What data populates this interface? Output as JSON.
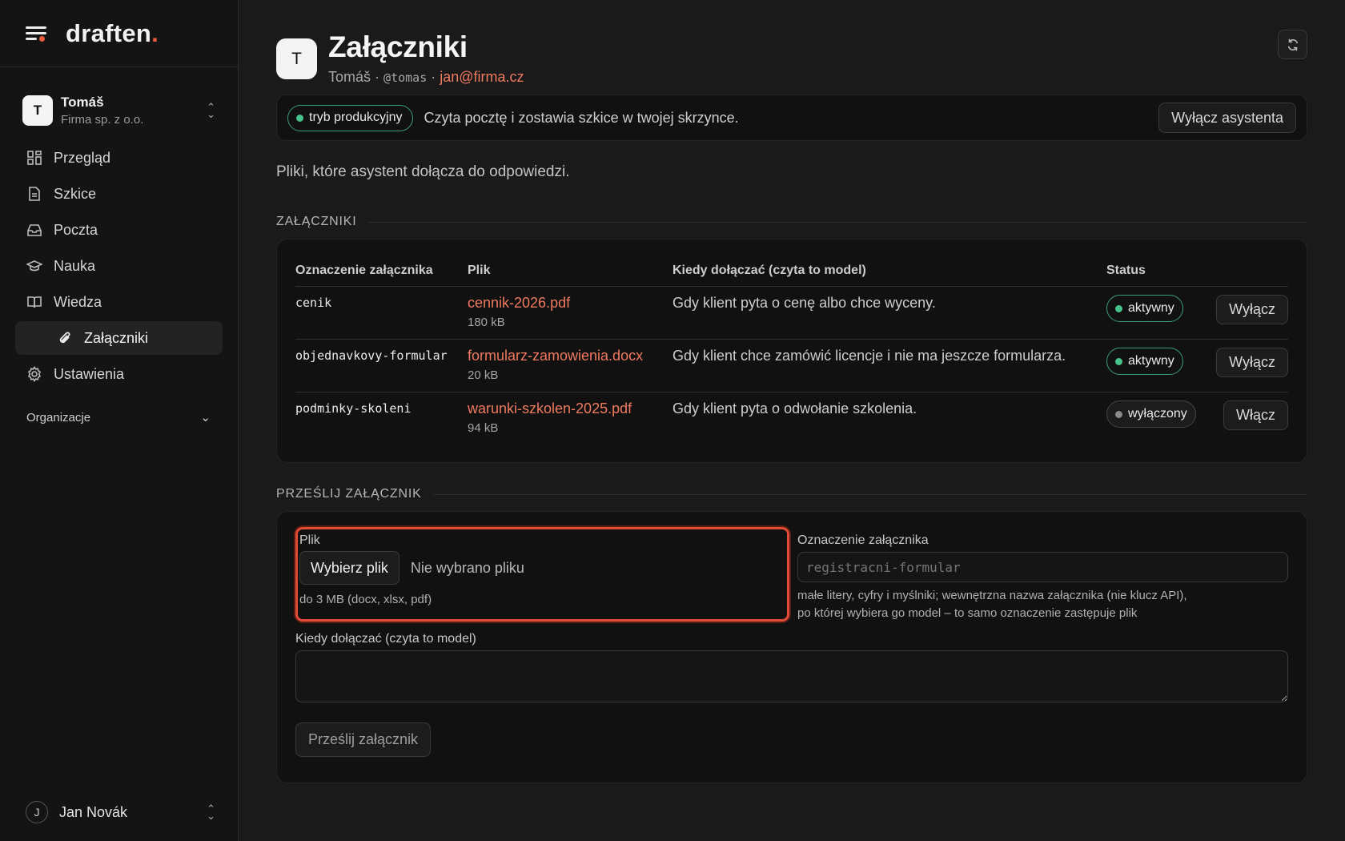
{
  "brand": {
    "name": "draften",
    "accent_dot": "."
  },
  "account": {
    "initial": "T",
    "name": "Tomáš",
    "org": "Firma sp. z o.o."
  },
  "nav": {
    "items": [
      {
        "label": "Przegląd",
        "icon": "grid-icon"
      },
      {
        "label": "Szkice",
        "icon": "document-icon"
      },
      {
        "label": "Poczta",
        "icon": "inbox-icon"
      },
      {
        "label": "Nauka",
        "icon": "graduation-cap-icon"
      },
      {
        "label": "Wiedza",
        "icon": "book-icon"
      }
    ],
    "sub_item": {
      "label": "Załączniki",
      "icon": "paperclip-icon"
    },
    "settings": {
      "label": "Ustawienia",
      "icon": "gear-icon"
    },
    "org_section": "Organizacje"
  },
  "user": {
    "initial": "J",
    "name": "Jan Novák"
  },
  "header": {
    "initial": "T",
    "title": "Załączniki",
    "name": "Tomáš",
    "separator": "·",
    "handle": "@tomas",
    "email": "jan@firma.cz"
  },
  "banner": {
    "mode": "tryb produkcyjny",
    "text": "Czyta pocztę i zostawia szkice w twojej skrzynce.",
    "button": "Wyłącz asystenta"
  },
  "intro": "Pliki, które asystent dołącza do odpowiedzi.",
  "attachments": {
    "section": "ZAŁĄCZNIKI",
    "columns": [
      "Oznaczenie załącznika",
      "Plik",
      "Kiedy dołączać (czyta to model)",
      "Status"
    ],
    "rows": [
      {
        "key": "cenik",
        "file": "cennik-2026.pdf",
        "size": "180 kB",
        "when": "Gdy klient pyta o cenę albo chce wyceny.",
        "status": "aktywny",
        "active": true,
        "action": "Wyłącz"
      },
      {
        "key": "objednavkovy-formular",
        "file": "formularz-zamowienia.docx",
        "size": "20 kB",
        "when": "Gdy klient chce zamówić licencje i nie ma jeszcze formularza.",
        "status": "aktywny",
        "active": true,
        "action": "Wyłącz"
      },
      {
        "key": "podminky-skoleni",
        "file": "warunki-szkolen-2025.pdf",
        "size": "94 kB",
        "when": "Gdy klient pyta o odwołanie szkolenia.",
        "status": "wyłączony",
        "active": false,
        "action": "Włącz"
      }
    ]
  },
  "upload": {
    "section": "PRZEŚLIJ ZAŁĄCZNIK",
    "file_label": "Plik",
    "file_button": "Wybierz plik",
    "file_status": "Nie wybrano pliku",
    "file_hint": "do 3 MB (docx, xlsx, pdf)",
    "key_label": "Oznaczenie załącznika",
    "key_placeholder": "registracni-formular",
    "key_help": "małe litery, cyfry i myślniki; wewnętrzna nazwa załącznika (nie klucz API), po której wybiera go model – to samo oznaczenie zastępuje plik",
    "when_label": "Kiedy dołączać (czyta to model)",
    "submit": "Prześlij załącznik"
  },
  "colors": {
    "accent": "#ef7a5f",
    "brand_dot": "#ea5a3d",
    "active_green": "#47c28a",
    "highlight_red": "#e24b35"
  }
}
